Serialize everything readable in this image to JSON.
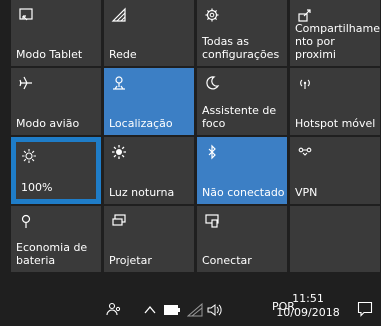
{
  "tiles": [
    {
      "label": "Modo Tablet",
      "icon": "tablet-mode-icon",
      "active": false
    },
    {
      "label": "Rede",
      "icon": "network-icon",
      "active": false
    },
    {
      "label": "Todas as\nconfigurações",
      "icon": "settings-gear-icon",
      "active": false
    },
    {
      "label": "Compartilhame\nnto por proximi",
      "icon": "nearby-sharing-icon",
      "active": false
    },
    {
      "label": "Modo avião",
      "icon": "airplane-icon",
      "active": false
    },
    {
      "label": "Localização",
      "icon": "location-icon",
      "active": true
    },
    {
      "label": "Assistente de\nfoco",
      "icon": "moon-icon",
      "active": false
    },
    {
      "label": "Hotspot móvel",
      "icon": "hotspot-icon",
      "active": false
    },
    {
      "label": "100%",
      "icon": "brightness-icon",
      "active": false
    },
    {
      "label": "Luz noturna",
      "icon": "night-light-icon",
      "active": false
    },
    {
      "label": "Não conectado",
      "icon": "bluetooth-icon",
      "active": true
    },
    {
      "label": "VPN",
      "icon": "vpn-icon",
      "active": false
    },
    {
      "label": "Economia de\nbateria",
      "icon": "battery-saver-icon",
      "active": false
    },
    {
      "label": "Projetar",
      "icon": "project-icon",
      "active": false
    },
    {
      "label": "Conectar",
      "icon": "connect-icon",
      "active": false
    }
  ],
  "taskbar": {
    "language": "POR",
    "time": "11:51",
    "date": "10/09/2018",
    "icons": [
      "people-icon",
      "chevron-up-icon",
      "battery-icon",
      "wifi-icon",
      "volume-icon",
      "notification-icon"
    ]
  },
  "colors": {
    "accent": "#3c7fc5",
    "tile": "#3a3a3a",
    "background": "#1f1f1f",
    "focus": "#1f7dc8"
  }
}
